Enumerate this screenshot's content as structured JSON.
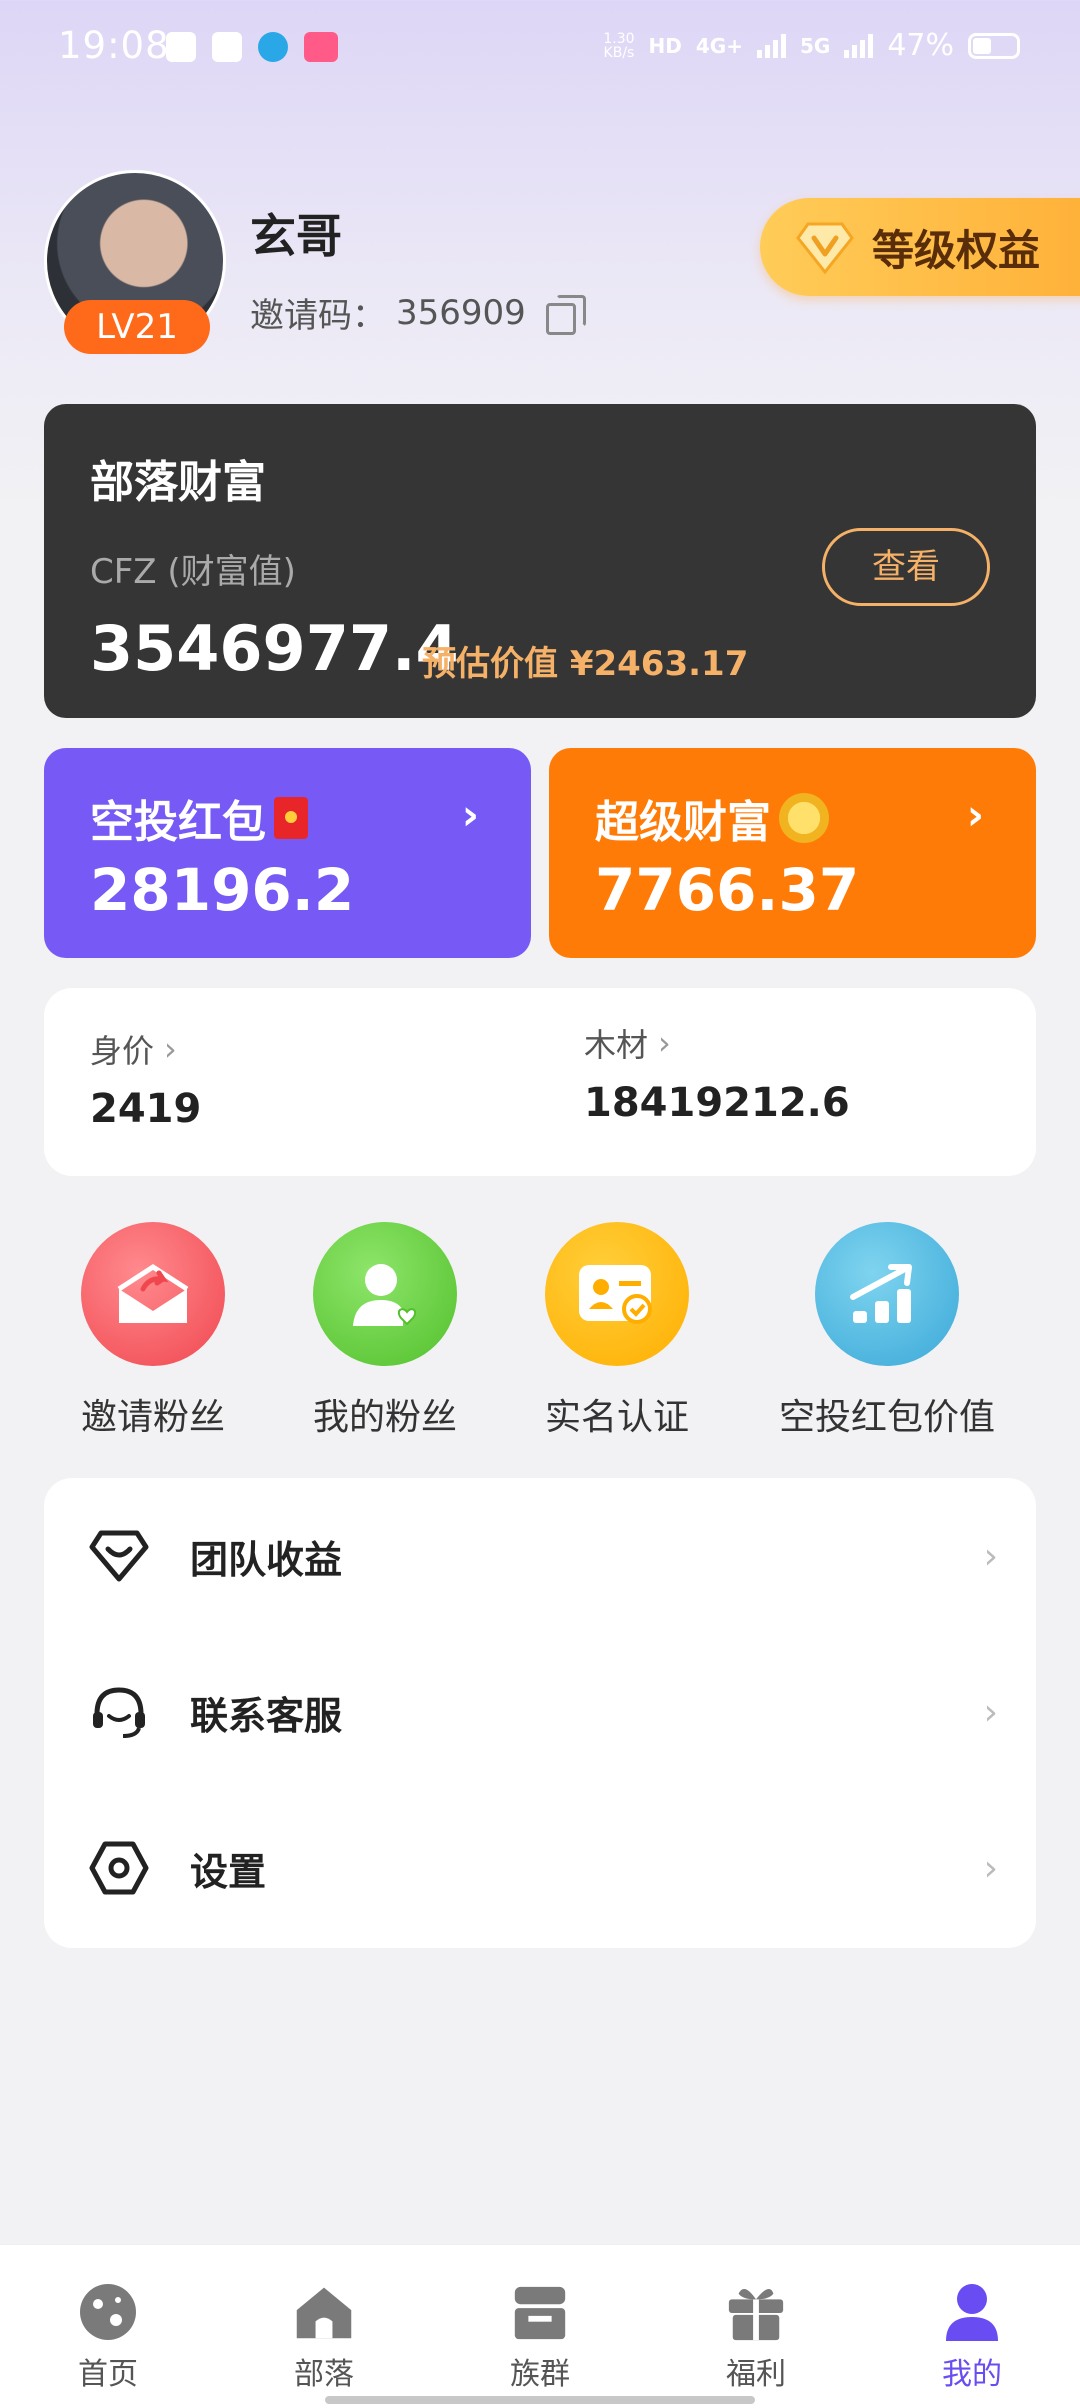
{
  "status_bar": {
    "time": "19:08",
    "net_speed_top": "1.30",
    "net_speed_bottom": "KB/s",
    "hd": "HD",
    "net_4g": "4G+",
    "net_5g": "5G",
    "battery": "47%"
  },
  "profile": {
    "level": "LV21",
    "name": "玄哥",
    "invite_label": "邀请码：",
    "invite_code": "356909",
    "level_rights_label": "等级权益"
  },
  "wealth_card": {
    "title": "部落财富",
    "subtitle": "CFZ (财富值)",
    "value": "3546977.4",
    "estimate": "预估价值 ¥2463.17",
    "view_button": "查看"
  },
  "airdrop_card": {
    "title": "空投红包",
    "value": "28196.2",
    "arrow": "›"
  },
  "super_wealth_card": {
    "title": "超级财富",
    "value": "7766.37",
    "arrow": "›"
  },
  "stats": {
    "worth_label": "身价",
    "worth_value": "2419",
    "wood_label": "木材",
    "wood_value": "18419212.6",
    "chevron": "›"
  },
  "quick_actions": {
    "invite_fans": "邀请粉丝",
    "my_fans": "我的粉丝",
    "verify": "实名认证",
    "airdrop_value": "空投红包价值"
  },
  "menu": {
    "team_income": "团队收益",
    "contact_service": "联系客服",
    "settings": "设置",
    "chevron": "›"
  },
  "bottom_nav": {
    "home": "首页",
    "tribe": "部落",
    "group": "族群",
    "welfare": "福利",
    "mine": "我的"
  },
  "colors": {
    "accent_purple": "#7759f5",
    "accent_orange": "#ff7b07",
    "gold": "#f5b167",
    "active_nav": "#6a4cf3"
  }
}
